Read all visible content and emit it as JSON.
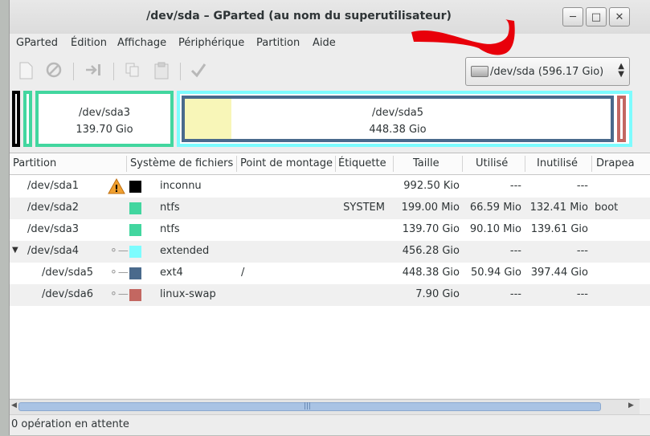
{
  "window": {
    "title": "/dev/sda – GParted (au nom du superutilisateur)",
    "min_glyph": "─",
    "max_glyph": "□",
    "close_glyph": "✕"
  },
  "menu": [
    "GParted",
    "Édition",
    "Affichage",
    "Périphérique",
    "Partition",
    "Aide"
  ],
  "device_selector": {
    "value": "/dev/sda  (596.17 Gio)"
  },
  "graph": {
    "sda3": {
      "name": "/dev/sda3",
      "size": "139.70 Gio"
    },
    "sda5": {
      "name": "/dev/sda5",
      "size": "448.38 Gio"
    }
  },
  "table": {
    "headers": [
      "Partition",
      "Système de fichiers",
      "Point de montage",
      "Étiquette",
      "Taille",
      "Utilisé",
      "Inutilisé",
      "Drapea"
    ],
    "rows": [
      {
        "partition": "/dev/sda1",
        "fs": "inconnu",
        "mount": "",
        "label": "",
        "size": "992.50 Kio",
        "used": "---",
        "unused": "---",
        "flags": "",
        "color": "#000000",
        "icon": "warning"
      },
      {
        "partition": "/dev/sda2",
        "fs": "ntfs",
        "mount": "",
        "label": "SYSTEM",
        "size": "199.00 Mio",
        "used": "66.59 Mio",
        "unused": "132.41 Mio",
        "flags": "boot",
        "color": "#42d69f",
        "icon": ""
      },
      {
        "partition": "/dev/sda3",
        "fs": "ntfs",
        "mount": "",
        "label": "",
        "size": "139.70 Gio",
        "used": "90.10 Mio",
        "unused": "139.61 Gio",
        "flags": "",
        "color": "#42d69f",
        "icon": ""
      },
      {
        "partition": "/dev/sda4",
        "fs": "extended",
        "mount": "",
        "label": "",
        "size": "456.28 Gio",
        "used": "---",
        "unused": "---",
        "flags": "",
        "color": "#7dfcfe",
        "icon": "key"
      },
      {
        "partition": "/dev/sda5",
        "fs": "ext4",
        "mount": "/",
        "label": "",
        "size": "448.38 Gio",
        "used": "50.94 Gio",
        "unused": "397.44 Gio",
        "flags": "",
        "color": "#4a6a8c",
        "icon": "key"
      },
      {
        "partition": "/dev/sda6",
        "fs": "linux-swap",
        "mount": "",
        "label": "",
        "size": "7.90 Gio",
        "used": "---",
        "unused": "---",
        "flags": "",
        "color": "#c36761",
        "icon": "key"
      }
    ]
  },
  "status": "0 opération en attente",
  "colors": {
    "ntfs": "#42d69f",
    "extended": "#7dfcfe",
    "ext4": "#4a6a8c",
    "swap": "#c36761",
    "used": "#f8f6b8",
    "annotation": "#e8000a"
  }
}
